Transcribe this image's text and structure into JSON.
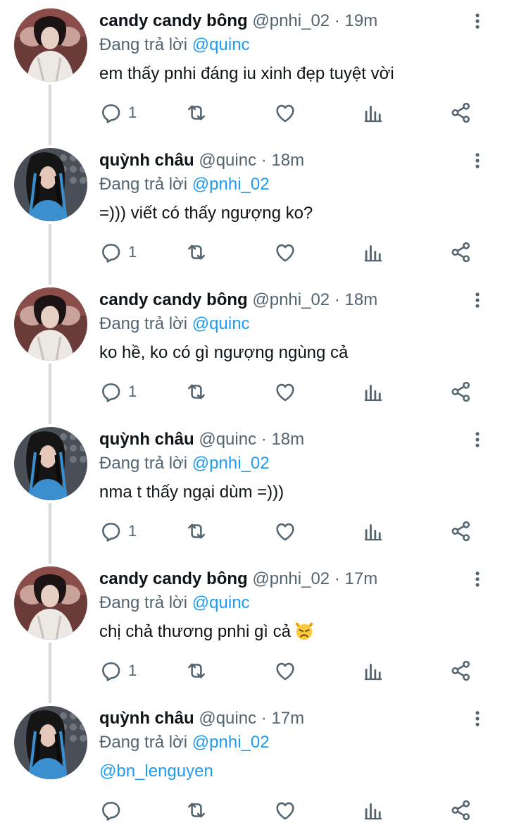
{
  "accent_color": "#1d9bf0",
  "muted_color": "#536471",
  "replying_prefix": "Đang trả lời",
  "tweets": [
    {
      "name": "candy candy bông",
      "handle": "@pnhi_02",
      "sep": "·",
      "time": "19m",
      "replying_to": "@quinc",
      "text": "em thấy pnhi đáng iu xinh đẹp tuyệt vời",
      "reply_count": "1",
      "avatar": "avatar-pnhi"
    },
    {
      "name": "quỳnh châu",
      "handle": "@quinc",
      "sep": "·",
      "time": "18m",
      "replying_to": "@pnhi_02",
      "text": "=))) viết có thấy ngượng ko?",
      "reply_count": "1",
      "avatar": "avatar-quinc"
    },
    {
      "name": "candy candy bông",
      "handle": "@pnhi_02",
      "sep": "·",
      "time": "18m",
      "replying_to": "@quinc",
      "text": "ko hề, ko có gì ngượng ngùng cả",
      "reply_count": "1",
      "avatar": "avatar-pnhi"
    },
    {
      "name": "quỳnh châu",
      "handle": "@quinc",
      "sep": "·",
      "time": "18m",
      "replying_to": "@pnhi_02",
      "text": "nma t thấy ngại dùm =)))",
      "reply_count": "1",
      "avatar": "avatar-quinc"
    },
    {
      "name": "candy candy bông",
      "handle": "@pnhi_02",
      "sep": "·",
      "time": "17m",
      "replying_to": "@quinc",
      "text": "chị chả thương pnhi gì cả",
      "emoji": "pouting-cat-emoji",
      "reply_count": "1",
      "avatar": "avatar-pnhi"
    },
    {
      "name": "quỳnh châu",
      "handle": "@quinc",
      "sep": "·",
      "time": "17m",
      "replying_to": "@pnhi_02",
      "text": "@bn_lenguyen",
      "reply_count": "",
      "avatar": "avatar-quinc"
    }
  ],
  "icons": [
    "reply-icon",
    "retweet-icon",
    "like-icon",
    "analytics-icon",
    "share-icon",
    "more-options-icon"
  ]
}
